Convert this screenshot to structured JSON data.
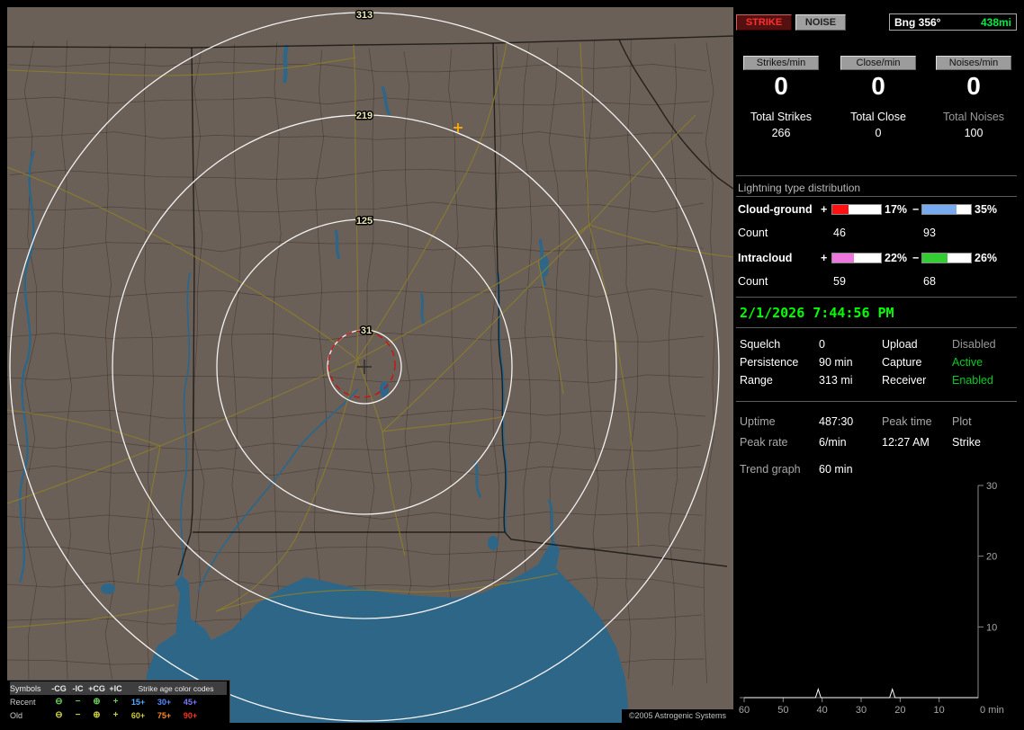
{
  "map": {
    "ring_labels": [
      "313",
      "219",
      "125",
      "31"
    ],
    "copyright": "©2005 Astrogenic Systems",
    "legend": {
      "header": "Symbols",
      "type_headers": [
        "-CG",
        "-IC",
        "+CG",
        "+IC"
      ],
      "age_header": "Strike age color codes",
      "symbols": [
        "⊖",
        "−",
        "⊕",
        "+"
      ],
      "rows": [
        {
          "label": "Recent",
          "symbol_color": "#66cc55",
          "ages": [
            {
              "text": "15+",
              "color": "#55aaff"
            },
            {
              "text": "30+",
              "color": "#5588ff"
            },
            {
              "text": "45+",
              "color": "#7777ff"
            }
          ]
        },
        {
          "label": "Old",
          "symbol_color": "#cccc44",
          "ages": [
            {
              "text": "60+",
              "color": "#cccc33"
            },
            {
              "text": "75+",
              "color": "#ff8822"
            },
            {
              "text": "90+",
              "color": "#ff3322"
            }
          ]
        }
      ]
    }
  },
  "panel": {
    "strike_button": "STRIKE",
    "noise_button": "NOISE",
    "bearing": {
      "label": "Bng 356°",
      "distance": "438mi",
      "distance_color": "#00ee44"
    },
    "rate_columns": [
      {
        "header": "Strikes/min",
        "rate": "0",
        "total_label": "Total Strikes",
        "total": "266",
        "total_label_color": "#ffffff"
      },
      {
        "header": "Close/min",
        "rate": "0",
        "total_label": "Total Close",
        "total": "0",
        "total_label_color": "#ffffff"
      },
      {
        "header": "Noises/min",
        "rate": "0",
        "total_label": "Total Noises",
        "total": "100",
        "total_label_color": "#9a9a9a"
      }
    ],
    "distribution": {
      "title": "Lightning type distribution",
      "count_label": "Count",
      "plus": "+",
      "minus": "−",
      "rows": [
        {
          "name": "Cloud-ground",
          "pos_pct": 17,
          "pos_pct_label": "17%",
          "pos_color": "#ff1111",
          "pos_count": "46",
          "neg_pct": 35,
          "neg_pct_label": "35%",
          "neg_color": "#77aaee",
          "neg_count": "93"
        },
        {
          "name": "Intracloud",
          "pos_pct": 22,
          "pos_pct_label": "22%",
          "pos_color": "#ee77dd",
          "pos_count": "59",
          "neg_pct": 26,
          "neg_pct_label": "26%",
          "neg_color": "#33cc33",
          "neg_count": "68"
        }
      ]
    },
    "datetime": "2/1/2026 7:44:56 PM",
    "datetime_color": "#00ff00",
    "settings": [
      {
        "label": "Squelch",
        "value": "0",
        "label2": "Upload",
        "value2": "Disabled",
        "value2_color": "#9a9a9a"
      },
      {
        "label": "Persistence",
        "value": "90 min",
        "label2": "Capture",
        "value2": "Active",
        "value2_color": "#00cc22"
      },
      {
        "label": "Range",
        "value": "313 mi",
        "label2": "Receiver",
        "value2": "Enabled",
        "value2_color": "#00cc22"
      }
    ],
    "stats": {
      "rows": [
        {
          "c1": "Uptime",
          "c2": "487:30",
          "c3": "Peak time",
          "c4": "Plot"
        },
        {
          "c1": "Peak rate",
          "c2": "6/min",
          "c3": "12:27 AM",
          "c4": "Strike"
        },
        {
          "c1": "Trend graph",
          "c2": "60 min",
          "c3": "",
          "c4": ""
        }
      ]
    }
  },
  "chart_data": {
    "type": "line",
    "title": "Strike rate trend, last 60 minutes",
    "xlabel": "min",
    "ylim": [
      0,
      30
    ],
    "xlim_minutes_ago": [
      60,
      0
    ],
    "y_ticks": [
      {
        "v": 30,
        "label": "30"
      },
      {
        "v": 20,
        "label": "20"
      },
      {
        "v": 10,
        "label": "10"
      }
    ],
    "x_ticks": [
      {
        "m": 60,
        "label": "60"
      },
      {
        "m": 50,
        "label": "50"
      },
      {
        "m": 40,
        "label": "40"
      },
      {
        "m": 30,
        "label": "30"
      },
      {
        "m": 20,
        "label": "20"
      },
      {
        "m": 10,
        "label": "10"
      }
    ],
    "origin_label": "0 min",
    "series": [
      {
        "name": "Strikes/min",
        "points": [
          {
            "minutes_ago": 60,
            "value": 0
          },
          {
            "minutes_ago": 41,
            "value": 1.2
          },
          {
            "minutes_ago": 22,
            "value": 1.2
          },
          {
            "minutes_ago": 0,
            "value": 0
          }
        ]
      }
    ]
  }
}
